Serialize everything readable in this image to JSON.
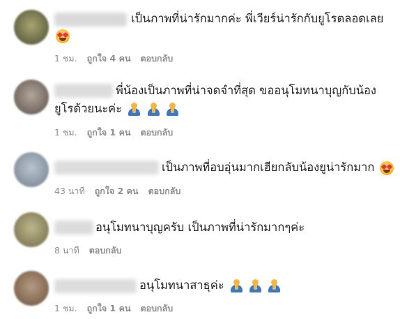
{
  "comments": [
    {
      "lines": [
        "เป็นภาพที่น่ารักมากค่ะ พี่เวียร์น่ารักกับยูโรตลอดเลย"
      ],
      "emoji_line": [
        "heart-eyes"
      ],
      "time": "1 ชม.",
      "likes": "ถูกใจ 4 คน",
      "reply": "ตอบกลับ"
    },
    {
      "lines": [
        "พี่น้องเป็นภาพที่น่าจดจำที่สุด ขออนุโมทนาบุญกับน้อง",
        "ยูโรด้วยนะค่ะ"
      ],
      "emoji_after_line2": [
        "pray",
        "pray",
        "pray"
      ],
      "time": "1 ชม.",
      "likes": "ถูกใจ 1 คน",
      "reply": "ตอบกลับ"
    },
    {
      "lines": [
        "เป็นภาพที่อบอุ่นมากเฮียกลับน้องยูน่ารักมาก"
      ],
      "emoji_inline": [
        "heart-eyes"
      ],
      "time": "43 นาที",
      "likes": "ถูกใจ 2 คน",
      "reply": "ตอบกลับ"
    },
    {
      "lines": [
        "อนุโมทนาบุญครับ เป็นภาพที่น่ารักมากๆค่ะ"
      ],
      "time": "8 นาที",
      "reply": "ตอบกลับ"
    },
    {
      "lines": [
        "อนุโมทนาสาธุค่ะ"
      ],
      "emoji_inline": [
        "pray",
        "pray",
        "pray"
      ],
      "time": "1 ชม.",
      "likes": "ถูกใจ 1 คน",
      "reply": "ตอบกลับ"
    }
  ],
  "colors": {
    "text": "#262626",
    "meta": "#8e8e8e"
  }
}
